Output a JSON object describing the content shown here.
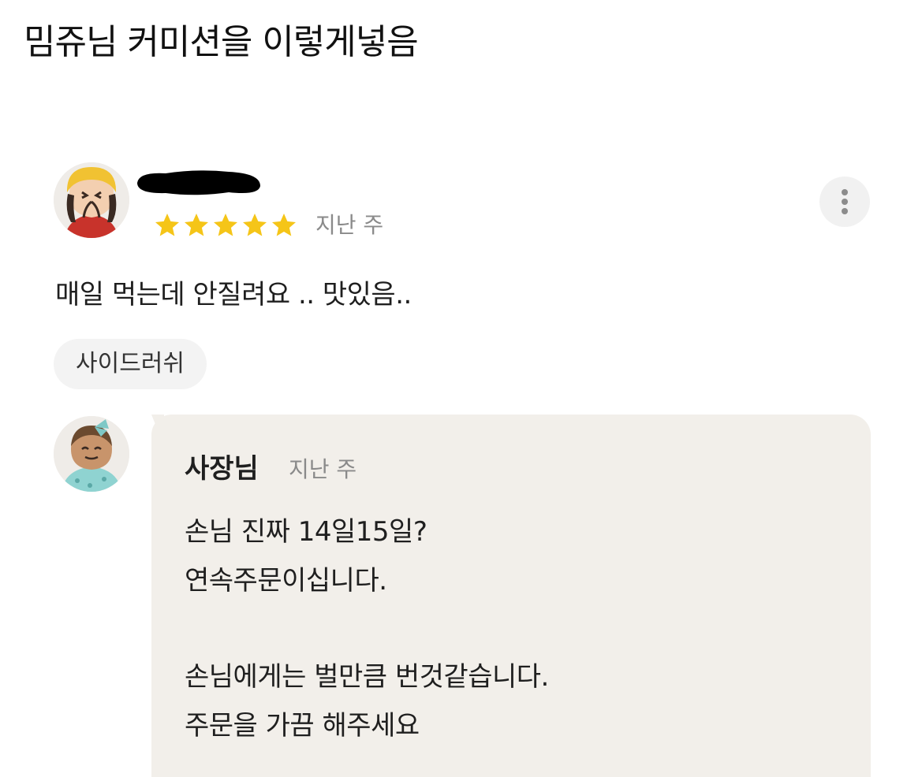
{
  "post": {
    "title": "밈쥬님 커미션을 이렇게넣음"
  },
  "review": {
    "rating": 5,
    "date": "지난 주",
    "body": "매일 먹는데 안질려요 .. 맛있음..",
    "menu_tag": "사이드러쉬",
    "star_color": "#f5c518"
  },
  "owner_reply": {
    "name": "사장님",
    "date": "지난 주",
    "lines": [
      "손님 진짜 14일15일?",
      "연속주문이십니다.",
      "손님에게는 벌만큼 번것같습니다.",
      "주문을 가끔 해주세요"
    ]
  },
  "icons": {
    "more": "more-vertical-icon",
    "star": "star-icon"
  }
}
